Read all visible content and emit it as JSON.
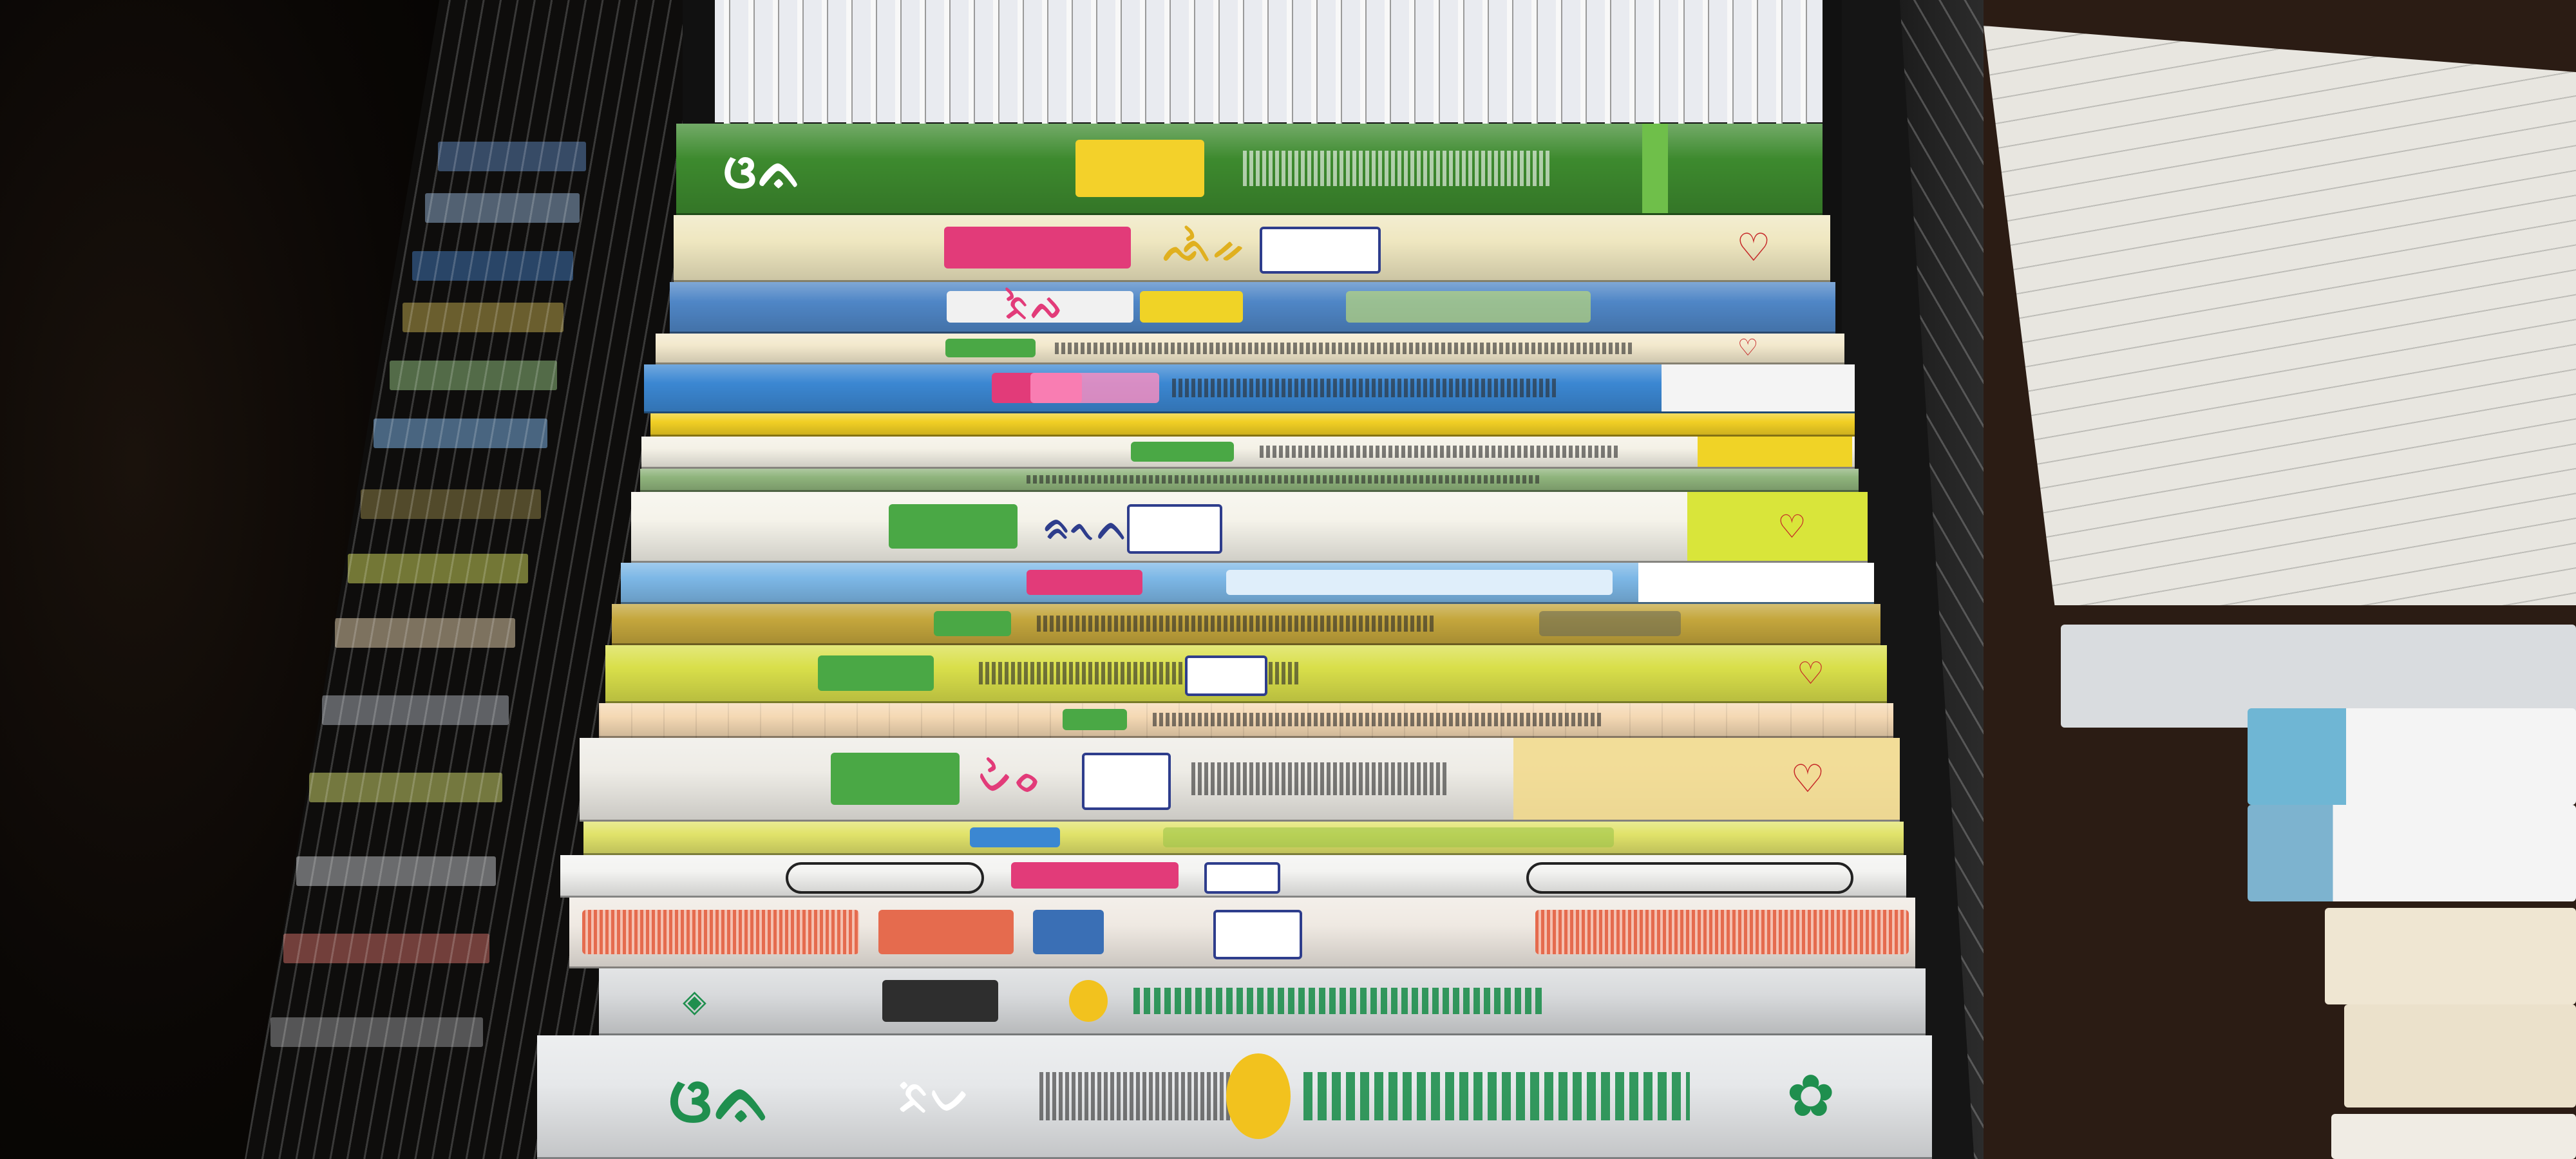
{
  "scene": {
    "subject": "books-in-drawer",
    "large_book_brand": "ᨴᨊ",
    "large_book_series": "ᨅᨗᨆ",
    "colors": {
      "drawer": "#111111",
      "green_book": "#3d8a2e",
      "yellow_book": "#f1d23a",
      "blue_book": "#3a83c9",
      "white_book": "#ece9e2",
      "coil": "#f5f5f5"
    }
  },
  "books": [
    {
      "color": "#3d8a2e",
      "label": "ᨴᨊ"
    },
    {
      "color": "#efe7c0",
      "label": "ᨒᨛᨀ"
    },
    {
      "color": "#4f86c6",
      "label": "ᨅᨛᨄ"
    },
    {
      "color": "#f3e9cd",
      "label": ""
    },
    {
      "color": "#3b87d2",
      "label": ""
    },
    {
      "color": "#f1cf24",
      "label": ""
    },
    {
      "color": "#f4f1e6",
      "label": ""
    },
    {
      "color": "#8fb47c",
      "label": ""
    },
    {
      "color": "#f5f3ea",
      "label": "ᨑᨚᨈ"
    },
    {
      "color": "#7cb7e6",
      "label": ""
    },
    {
      "color": "#c4a63c",
      "label": ""
    },
    {
      "color": "#d9df4a",
      "label": ""
    },
    {
      "color": "#f5d9b4",
      "label": ""
    },
    {
      "color": "#eeece6",
      "label": "ᨆᨛᨔ"
    },
    {
      "color": "#e1e36a",
      "label": ""
    },
    {
      "color": "#f3f3f1",
      "label": ""
    },
    {
      "color": "#efe9e2",
      "label": ""
    },
    {
      "color": "#d8dadc",
      "label": ""
    },
    {
      "color": "#e6e8ea",
      "label": "ᨴᨊ"
    }
  ]
}
